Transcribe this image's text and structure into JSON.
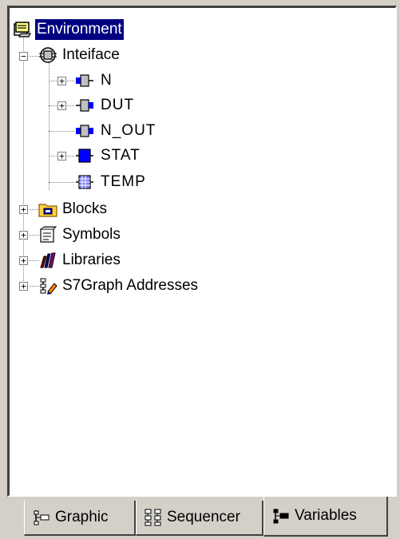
{
  "tree": {
    "root": {
      "label": "Environment",
      "icon": "environment-icon"
    },
    "interface": {
      "label": "Inteiface",
      "icon": "interface-icon"
    },
    "items": [
      {
        "label": "N",
        "icon": "param-in-icon",
        "expander": "+"
      },
      {
        "label": "DUT",
        "icon": "param-out-icon",
        "expander": "+"
      },
      {
        "label": "N_OUT",
        "icon": "param-inout-icon",
        "expander": ""
      },
      {
        "label": "STAT",
        "icon": "param-stat-icon",
        "expander": "+"
      },
      {
        "label": "TEMP",
        "icon": "param-temp-icon",
        "expander": ""
      }
    ],
    "groups": [
      {
        "label": "Blocks",
        "icon": "blocks-folder-icon",
        "expander": "+"
      },
      {
        "label": "Symbols",
        "icon": "symbols-icon",
        "expander": "+"
      },
      {
        "label": "Libraries",
        "icon": "libraries-icon",
        "expander": "+"
      },
      {
        "label": "S7Graph Addresses",
        "icon": "s7graph-addresses-icon",
        "expander": "+"
      }
    ]
  },
  "tabs": [
    {
      "label": "Graphic",
      "icon": "graphic-tab-icon"
    },
    {
      "label": "Sequencer",
      "icon": "sequencer-tab-icon"
    },
    {
      "label": "Variables",
      "icon": "variables-tab-icon",
      "active": true
    }
  ],
  "colors": {
    "selection": "#000080",
    "face": "#d4d0c8"
  }
}
